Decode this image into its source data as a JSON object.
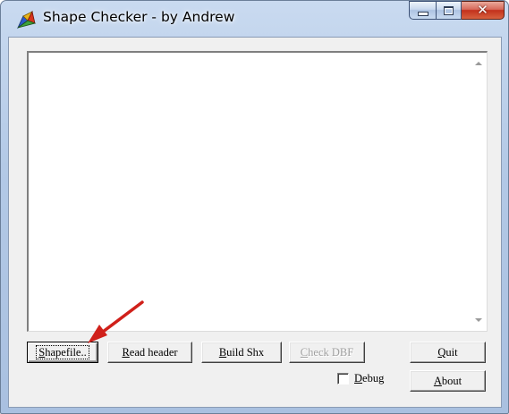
{
  "window": {
    "title": "Shape Checker - by Andrew",
    "app_icon": "colorful-shape-icon",
    "controls": {
      "minimize": "minimize-icon",
      "maximize": "maximize-icon",
      "close": "close-icon"
    }
  },
  "output": {
    "text": ""
  },
  "buttons": {
    "shapefile": {
      "mnemonic": "S",
      "rest": "hapefile.."
    },
    "read_header": {
      "mnemonic": "R",
      "rest": "ead header"
    },
    "build_shx": {
      "mnemonic": "B",
      "rest": "uild Shx"
    },
    "check_dbf": {
      "mnemonic": "C",
      "rest": "heck DBF",
      "enabled": false
    },
    "quit": {
      "mnemonic": "Q",
      "rest": "uit"
    },
    "about": {
      "mnemonic": "A",
      "rest": "bout"
    }
  },
  "debug": {
    "mnemonic": "D",
    "rest": "ebug",
    "checked": false
  },
  "annotation": {
    "arrow_color": "#d0201a"
  },
  "colors": {
    "dialog_face": "#f0f0f0",
    "titlebar": "#b3c9e6",
    "close_button": "#c3311c"
  }
}
